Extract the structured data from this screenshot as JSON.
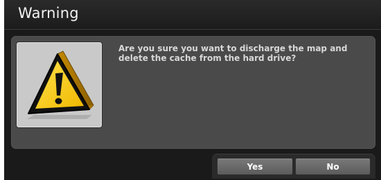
{
  "dialog": {
    "title": "Warning",
    "message": "Are you sure you want to discharge the map and delete the cache from the hard drive?",
    "icon": "warning-triangle-icon",
    "buttons": {
      "yes_label": "Yes",
      "no_label": "No"
    }
  },
  "colors": {
    "title_bar": "#1c1c1c",
    "panel": "#4a4a4a",
    "button": "#6a6a6a",
    "warning_yellow": "#f6c400"
  }
}
